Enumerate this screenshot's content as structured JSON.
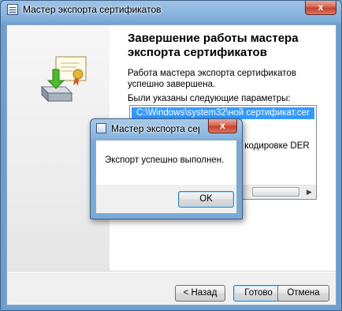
{
  "window": {
    "title": "Мастер экспорта сертификатов",
    "close_label": "x"
  },
  "wizard": {
    "heading": "Завершение работы мастера экспорта сертификатов",
    "description": "Работа мастера экспорта сертификатов успешно завершена.",
    "params_label": "Были указаны следующие параметры:",
    "params": [
      "C:\\Windows\\system32\\ной сертификат.cer",
      "в кодировке DER"
    ]
  },
  "buttons": {
    "back": "< Назад",
    "finish": "Готово",
    "cancel": "Отмена"
  },
  "message_box": {
    "title": "Мастер экспорта сертиф",
    "text": "Экспорт успешно выполнен.",
    "ok_label": "OK",
    "close_label": "x"
  },
  "colors": {
    "frame": "#6c9fcf",
    "close": "#c4402a",
    "selection": "#3399ff"
  }
}
